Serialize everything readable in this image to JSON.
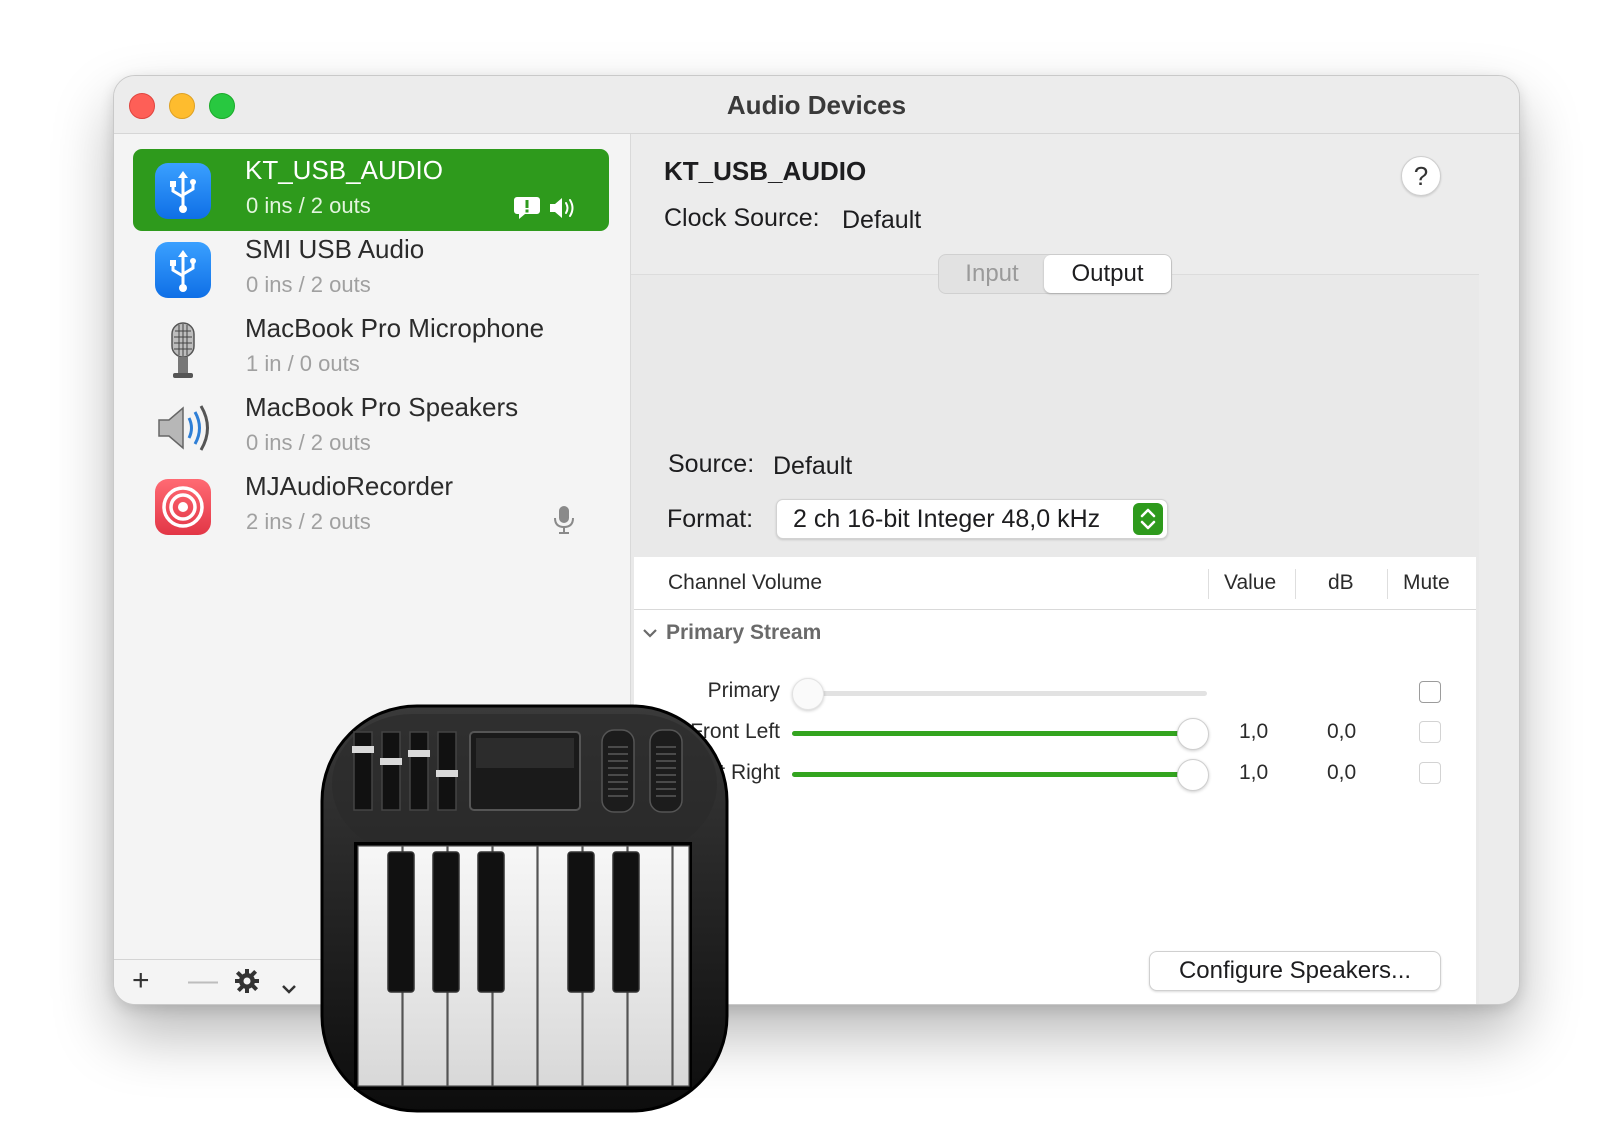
{
  "window": {
    "title": "Audio Devices"
  },
  "devices": [
    {
      "name": "KT_USB_AUDIO",
      "io": "0 ins / 2 outs",
      "icon": "usb-icon",
      "selected": true
    },
    {
      "name": "SMI USB Audio",
      "io": "0 ins / 2 outs",
      "icon": "usb-icon",
      "selected": false
    },
    {
      "name": "MacBook Pro Microphone",
      "io": "1 in / 0 outs",
      "icon": "microphone-icon",
      "selected": false
    },
    {
      "name": "MacBook Pro Speakers",
      "io": "0 ins / 2 outs",
      "icon": "speaker-icon",
      "selected": false
    },
    {
      "name": "MJAudioRecorder",
      "io": "2 ins / 2 outs",
      "icon": "recorder-icon",
      "selected": false
    }
  ],
  "sidebar_footer": {
    "add": "+",
    "remove": "—"
  },
  "detail": {
    "device_name": "KT_USB_AUDIO",
    "help": "?",
    "clock_label": "Clock Source:",
    "clock_value": "Default",
    "tabs": [
      "Input",
      "Output"
    ],
    "active_tab": "Output",
    "source_label": "Source:",
    "source_value": "Default",
    "format_label": "Format:",
    "format_value": "2 ch 16-bit Integer 48,0 kHz",
    "columns": [
      "Channel Volume",
      "Value",
      "dB",
      "Mute"
    ],
    "group": "Primary Stream",
    "channels": [
      {
        "label": "Primary",
        "level": 0.0,
        "value": "",
        "db": "",
        "mute_enabled": true
      },
      {
        "label": "Front Left",
        "level": 1.0,
        "value": "1,0",
        "db": "0,0",
        "mute_enabled": false
      },
      {
        "label": "Front Right",
        "level": 1.0,
        "value": "1,0",
        "db": "0,0",
        "mute_enabled": false
      }
    ],
    "configure_button": "Configure Speakers..."
  },
  "colors": {
    "accent": "#2e9a1c",
    "slider_fill": "#33a41f"
  }
}
